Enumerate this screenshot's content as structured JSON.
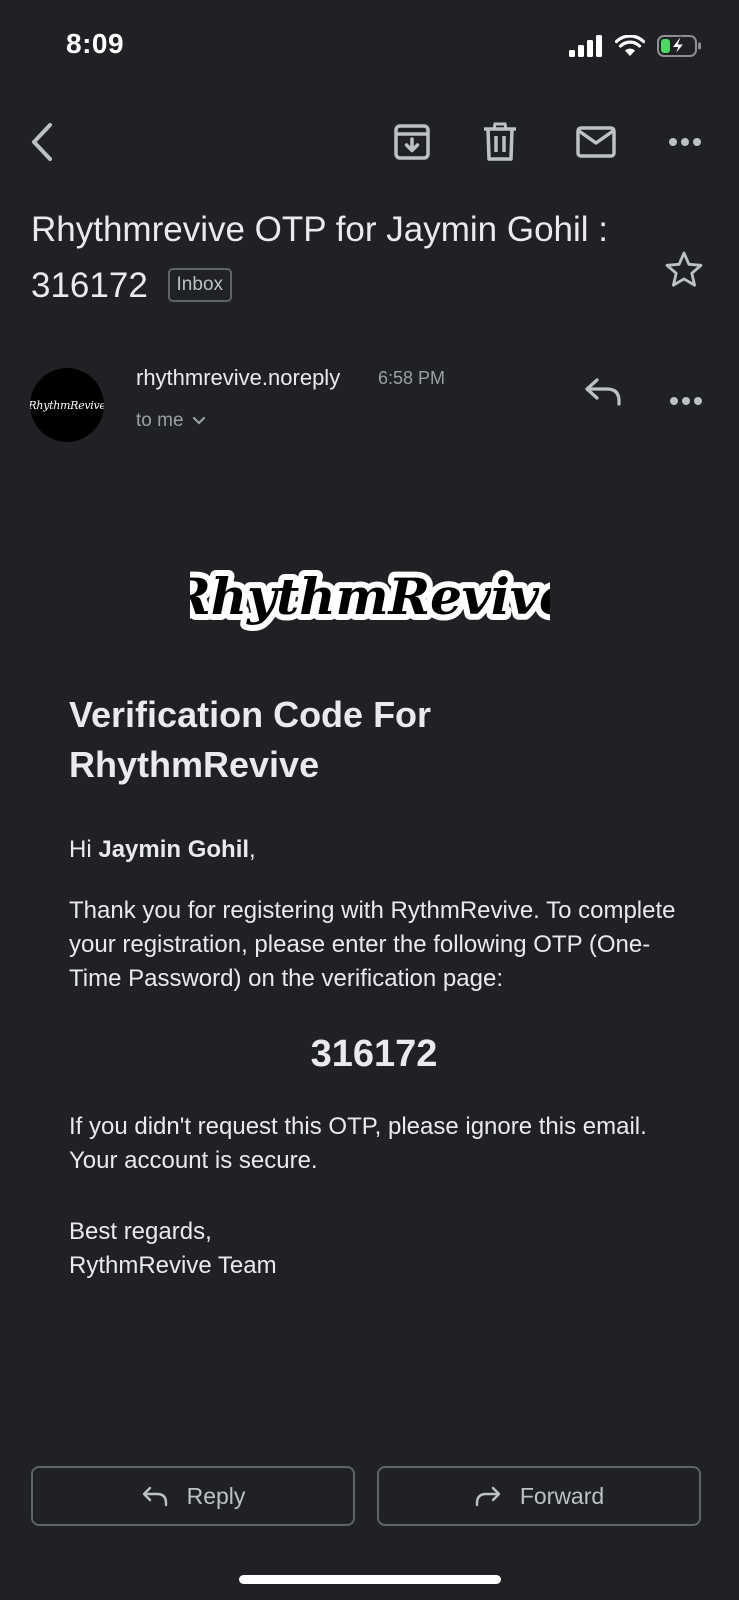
{
  "status_bar": {
    "time": "8:09"
  },
  "toolbar": {
    "back": "back-arrow-icon",
    "archive": "archive-icon",
    "delete": "trash-icon",
    "mark_unread": "mail-icon",
    "more": "more-horizontal-icon"
  },
  "subject": {
    "text": "Rhythmrevive OTP for Jaymin Gohil : 316172",
    "label": "Inbox"
  },
  "message": {
    "avatar_text": "RhythmRevive",
    "sender": "rhythmrevive.noreply",
    "time": "6:58 PM",
    "recipient": "to me"
  },
  "email_body": {
    "logo_text": "RhythmRevive",
    "heading": "Verification Code For RhythmRevive",
    "greeting_prefix": "Hi ",
    "greeting_name": "Jaymin Gohil",
    "greeting_suffix": ",",
    "intro": "Thank you for registering with RythmRevive. To complete your registration, please enter the following OTP (One-Time Password) on the verification page:",
    "otp": "316172",
    "ignore_notice": "If you didn't request this OTP, please ignore this email. Your account is secure.",
    "sign_off": "Best regards,",
    "signature": "RythmRevive Team"
  },
  "actions": {
    "reply_label": "Reply",
    "forward_label": "Forward"
  },
  "colors": {
    "background": "#202124",
    "text": "#e8eaed",
    "secondary_text": "#9aa0a6",
    "border": "#5f6368",
    "battery_charging": "#4cd964"
  }
}
